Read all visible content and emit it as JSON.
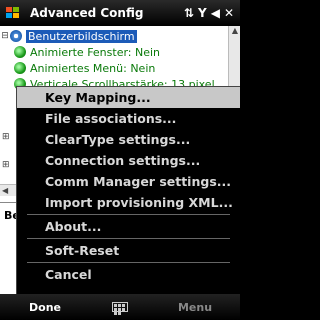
{
  "titlebar": {
    "title": "Advanced Config",
    "status_icons": [
      "sync-icon",
      "signal-icon",
      "volume-icon",
      "close-icon"
    ],
    "close_label": "✕"
  },
  "tree": {
    "root": "Benutzerbildschirm",
    "children": [
      "Animierte Fenster: Nein",
      "Animiertes Menü: Nein",
      "Verticale Scrollbarstärke: 13 pixel"
    ]
  },
  "details": {
    "text": "Be"
  },
  "menu": {
    "items": [
      "Key Mapping...",
      "File associations...",
      "ClearType settings...",
      "Connection settings...",
      "Comm Manager settings...",
      "Import provisioning XML...",
      "About...",
      "Soft-Reset",
      "Cancel"
    ],
    "highlighted_index": 0
  },
  "softkeys": {
    "left": "Done",
    "right": "Menu"
  }
}
